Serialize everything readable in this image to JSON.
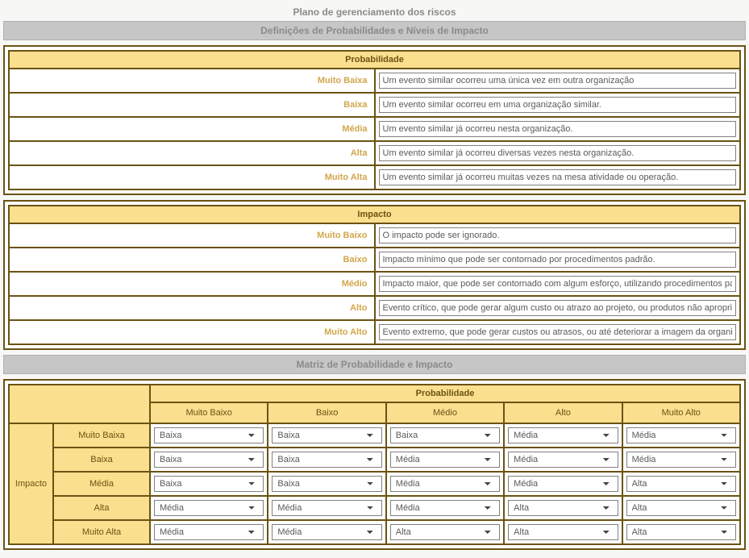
{
  "page_title": "Plano de gerenciamento dos riscos",
  "section_definitions": "Definições de Probabilidades e Níveis de Impacto",
  "probability": {
    "header": "Probabilidade",
    "rows": [
      {
        "label": "Muito Baixa",
        "value": "Um evento similar ocorreu uma única vez em outra organização"
      },
      {
        "label": "Baixa",
        "value": "Um evento similar ocorreu em uma organização similar."
      },
      {
        "label": "Média",
        "value": "Um evento similar já ocorreu nesta organização."
      },
      {
        "label": "Alta",
        "value": "Um evento similar já ocorreu diversas vezes nesta organização."
      },
      {
        "label": "Muito Alta",
        "value": "Um evento similar já ocorreu muitas vezes na mesa atividade ou operação."
      }
    ]
  },
  "impact": {
    "header": "Impacto",
    "rows": [
      {
        "label": "Muito Baixo",
        "value": "O impacto pode ser ignorado."
      },
      {
        "label": "Baixo",
        "value": "Impacto mínimo que pode ser contornado por procedimentos padrão."
      },
      {
        "label": "Médio",
        "value": "Impacto maior, que pode ser contornado com algum esforço, utilizando procedimentos padrão."
      },
      {
        "label": "Alto",
        "value": "Evento crítico, que pode gerar algum custo ou atrazo ao projeto, ou produtos não apropriados."
      },
      {
        "label": "Muito Alto",
        "value": "Evento extremo, que pode gerar custos ou atrasos, ou até deteriorar a imagem da organização."
      }
    ]
  },
  "section_matrix": "Matriz de Probabilidade e Impacto",
  "matrix": {
    "prob_header": "Probabilidade",
    "impact_header": "Impacto",
    "prob_cols": [
      "Muito Baixo",
      "Baixo",
      "Médio",
      "Alto",
      "Muito Alto"
    ],
    "impact_rows": [
      "Muito Baixa",
      "Baixa",
      "Média",
      "Alta",
      "Muito Alta"
    ],
    "options": [
      "Baixa",
      "Média",
      "Alta"
    ],
    "cells": [
      [
        "Baixa",
        "Baixa",
        "Baixa",
        "Média",
        "Média"
      ],
      [
        "Baixa",
        "Baixa",
        "Média",
        "Média",
        "Média"
      ],
      [
        "Baixa",
        "Baixa",
        "Média",
        "Média",
        "Alta"
      ],
      [
        "Média",
        "Média",
        "Média",
        "Alta",
        "Alta"
      ],
      [
        "Média",
        "Média",
        "Alta",
        "Alta",
        "Alta"
      ]
    ]
  }
}
